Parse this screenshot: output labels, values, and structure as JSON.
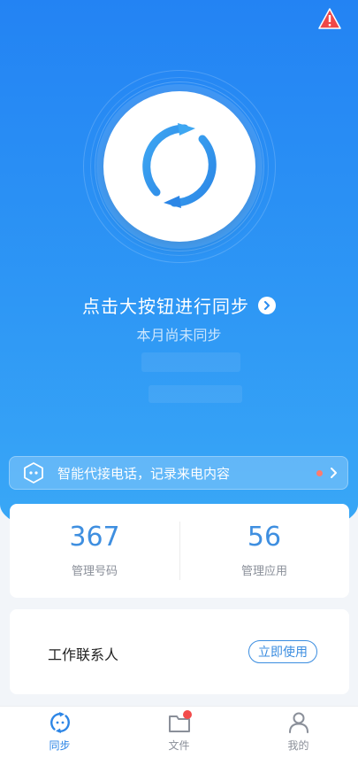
{
  "header": {
    "warning_icon": "warning-triangle-icon"
  },
  "sync": {
    "button_icon": "sync-refresh-icon",
    "title": "点击大按钮进行同步",
    "subtitle": "本月尚未同步"
  },
  "promo": {
    "icon": "robot-face-icon",
    "text": "智能代接电话，记录来电内容"
  },
  "stats": [
    {
      "value": "367",
      "label": "管理号码"
    },
    {
      "value": "56",
      "label": "管理应用"
    }
  ],
  "contact": {
    "title": "工作联系人",
    "button_label": "立即使用"
  },
  "tabs": [
    {
      "label": "同步",
      "icon": "sync-icon",
      "active": true
    },
    {
      "label": "文件",
      "icon": "folder-icon",
      "badge": true
    },
    {
      "label": "我的",
      "icon": "person-icon"
    }
  ],
  "colors": {
    "accent": "#2d86e6",
    "hero_top": "#2383f3",
    "hero_bottom": "#3aa9f6",
    "badge": "#f24b4b"
  }
}
